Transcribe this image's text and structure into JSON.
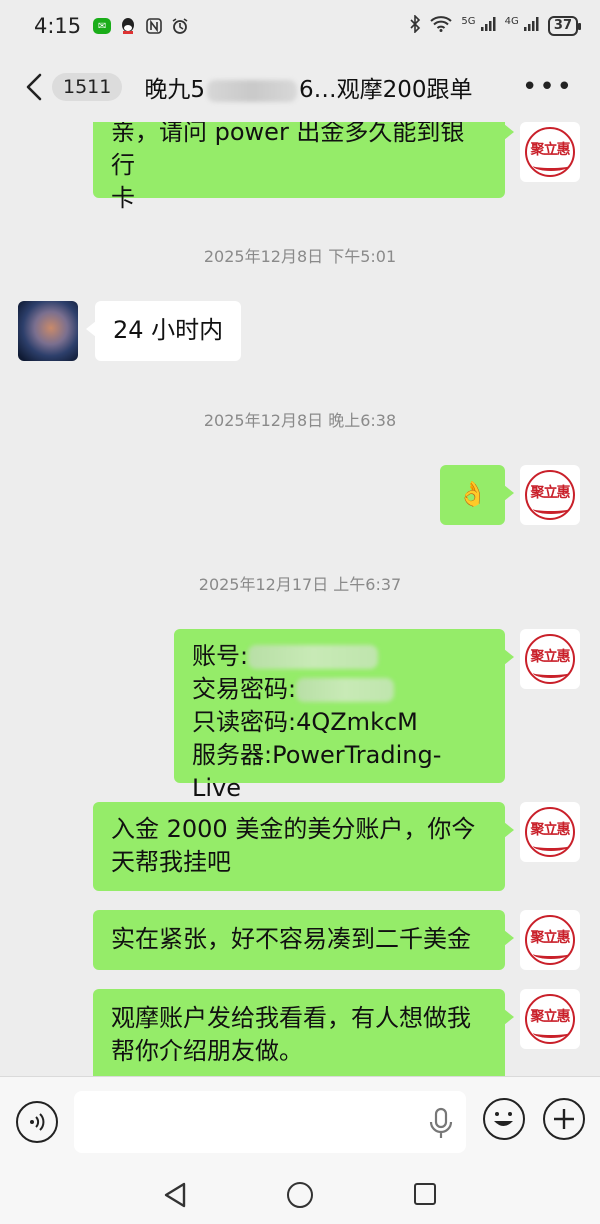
{
  "status_bar": {
    "time": "4:15",
    "battery": "37",
    "network_label_1": "5G",
    "network_label_2": "4G"
  },
  "header": {
    "unread_count": "1511",
    "title_prefix": "晚九5",
    "title_suffix": "6…观摩200跟单"
  },
  "messages": {
    "m1": {
      "line1": "亲，请问 power  出金多久能到银行",
      "line2": "卡"
    },
    "ts1": "2025年12月8日 下午5:01",
    "m2": "24 小时内",
    "ts2": "2025年12月8日 晚上6:38",
    "m3_emoji": "👌",
    "ts3": "2025年12月17日 上午6:37",
    "m4": {
      "account_label": "账号:",
      "trade_pw_label": "交易密码:",
      "readonly_pw": "只读密码:4QZmkcM",
      "server": "服务器:PowerTrading-Live"
    },
    "m5": {
      "line1": "入金 2000 美金的美分账户，你今",
      "line2": "天帮我挂吧"
    },
    "m6": "实在紧张，好不容易凑到二千美金",
    "m7": {
      "line1": "观摩账户发给我看看，有人想做我",
      "line2": "帮你介绍朋友做。"
    }
  },
  "avatar": {
    "logo_text": "聚立惠"
  },
  "colors": {
    "outgoing_bubble": "#95ec69",
    "incoming_bubble": "#ffffff",
    "background": "#ededed",
    "logo_red": "#c9202a"
  }
}
